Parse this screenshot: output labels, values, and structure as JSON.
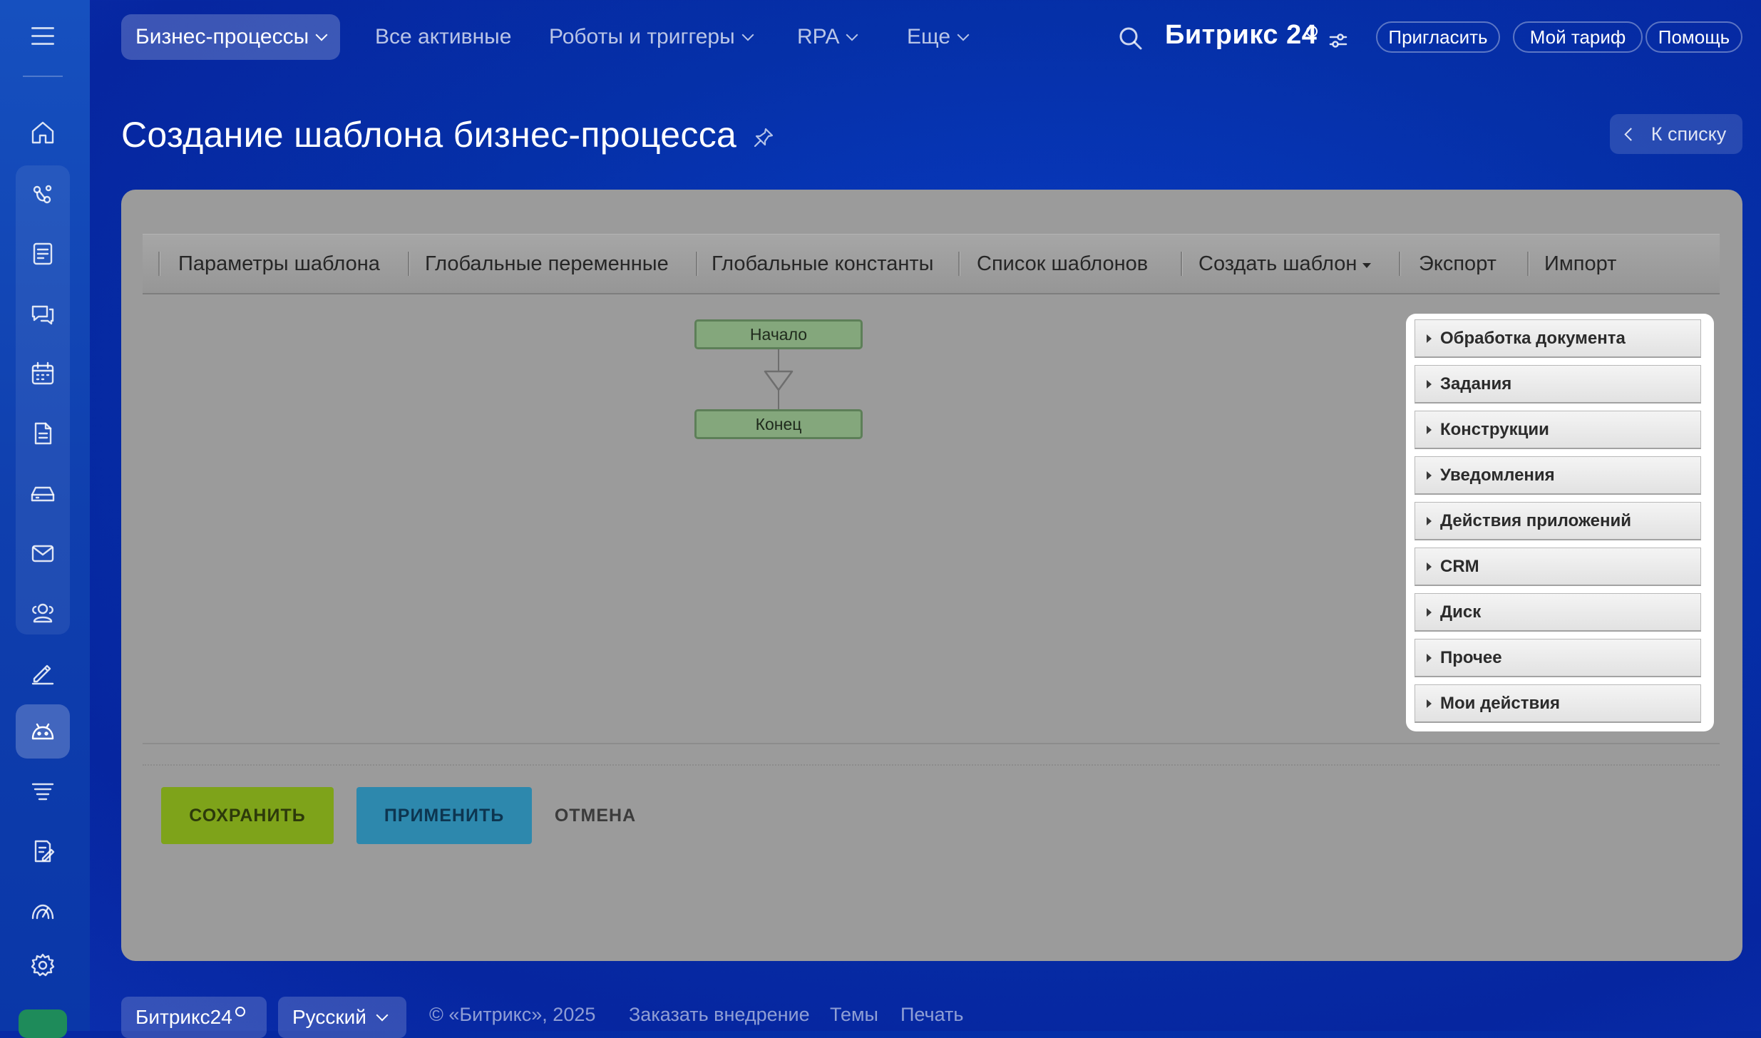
{
  "topnav": {
    "items": [
      {
        "label": "Бизнес-процессы",
        "active": true,
        "dropdown": true
      },
      {
        "label": "Все активные",
        "active": false,
        "dropdown": false
      },
      {
        "label": "Роботы и триггеры",
        "active": false,
        "dropdown": true
      },
      {
        "label": "RPA",
        "active": false,
        "dropdown": true
      },
      {
        "label": "Еще",
        "active": false,
        "dropdown": true
      }
    ],
    "brand": "Битрикс 24",
    "invite": "Пригласить",
    "tariff": "Мой тариф",
    "help": "Помощь"
  },
  "page": {
    "title": "Создание шаблона бизнес-процесса",
    "back_label": "К списку"
  },
  "toolbar": {
    "items": [
      "Параметры шаблона",
      "Глобальные переменные",
      "Глобальные константы",
      "Список шаблонов",
      "Создать шаблон",
      "Экспорт",
      "Импорт"
    ]
  },
  "flow": {
    "start": "Начало",
    "end": "Конец"
  },
  "palette": {
    "items": [
      "Обработка документа",
      "Задания",
      "Конструкции",
      "Уведомления",
      "Действия приложений",
      "CRM",
      "Диск",
      "Прочее",
      "Мои действия"
    ]
  },
  "buttons": {
    "save": "СОХРАНИТЬ",
    "apply": "ПРИМЕНИТЬ",
    "cancel": "ОТМЕНА"
  },
  "footer": {
    "brand": "Битрикс24",
    "language": "Русский",
    "copyright": "© «Битрикс», 2025",
    "order": "Заказать внедрение",
    "themes": "Темы",
    "print": "Печать"
  },
  "colors": {
    "save_button": "#7ea31a",
    "apply_button": "#2d88ad",
    "flow_node": "#84a77c",
    "background": "#0530a8"
  },
  "sidebar": {
    "icons": [
      "menu-icon",
      "home-icon",
      "feed-icon",
      "tasks-icon",
      "chat-icon",
      "calendar-icon",
      "documents-icon",
      "drive-icon",
      "mail-icon",
      "contacts-icon",
      "sign-icon",
      "automation-icon",
      "crm-icon",
      "forms-icon",
      "analytics-icon",
      "settings-icon"
    ]
  }
}
